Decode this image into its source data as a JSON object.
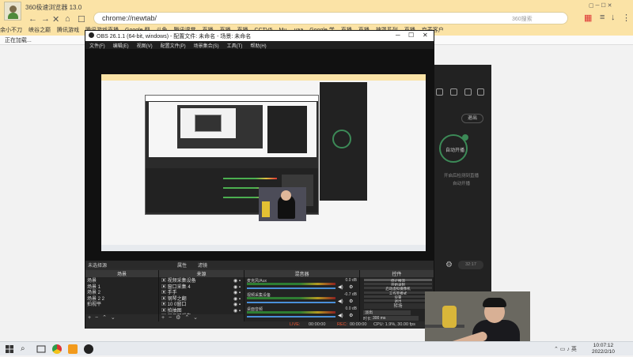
{
  "browser": {
    "title": "360极速浏览器 13.0",
    "address": "chrome://newtab/",
    "search_placeholder": "360搜索",
    "bookmarks": [
      "余小不刀",
      "峡谷之巅",
      "腾讯游戏",
      "腾讯游戏直播",
      "Google 翻",
      "斗鱼",
      "腾讯课堂",
      "直播",
      "直播",
      "直播",
      "CCTV5",
      "Mu..._vaa",
      "Google 学",
      "直播",
      "直播",
      "神罩系列",
      "直播",
      "京麦客户"
    ],
    "tab_label": "正在加载..."
  },
  "obs": {
    "title": "OBS 26.1.1 (64-bit, windows) - 配置文件: 未命名 - 场景: 未命名",
    "menu": [
      "文件(F)",
      "编辑(E)",
      "视图(V)",
      "配置文件(P)",
      "场景集合(S)",
      "工具(T)",
      "帮助(H)"
    ],
    "scene_bar": "未选择源",
    "scene_bar_props": "属性",
    "scene_bar_filters": "滤镜",
    "scenes_header": "场景",
    "scenes": [
      "场景",
      "场景 1",
      "场景 2",
      "场景 2 2",
      "拍视平"
    ],
    "sources_header": "来源",
    "sources": [
      "视频采集设备",
      "窗口采集 4",
      "手手",
      "钢琴之翻",
      "10 0窗口",
      "拍抽图",
      "显示器采集"
    ],
    "mixer_header": "混音器",
    "mixer": [
      {
        "name": "麦克风/Aux",
        "db": "0.0 dB"
      },
      {
        "name": "视频采集设备",
        "db": "-0.7 dB"
      },
      {
        "name": "桌面音频",
        "db": "0.0 dB"
      }
    ],
    "transitions_header": "转场",
    "transition_select": "淡出",
    "duration_label": "时长",
    "duration_value": "300 ms",
    "controls_header": "控件",
    "controls": [
      "停止推流",
      "开始录制",
      "启动虚拟摄像机",
      "工作室模式",
      "设置",
      "退出"
    ],
    "status": {
      "live_label": "LIVE:",
      "live_time": "00:00:00",
      "rec_label": "REC:",
      "rec_time": "00:00:00",
      "cpu": "CPU: 1.9%, 30.00 fps"
    }
  },
  "dark_app": {
    "exit_label": "退出",
    "circle_label": "自动开播",
    "info_line1": "开启后检测到直播",
    "info_line2": "自动开播",
    "time_label": "32:17"
  },
  "taskbar": {
    "time": "10:07:12",
    "date": "2022/2/10"
  },
  "colors": {
    "browser_chrome": "#fbe3a6",
    "obs_dark": "#2c2c2c",
    "accent_green": "#3c8a57",
    "meter_green": "#4caf50"
  }
}
